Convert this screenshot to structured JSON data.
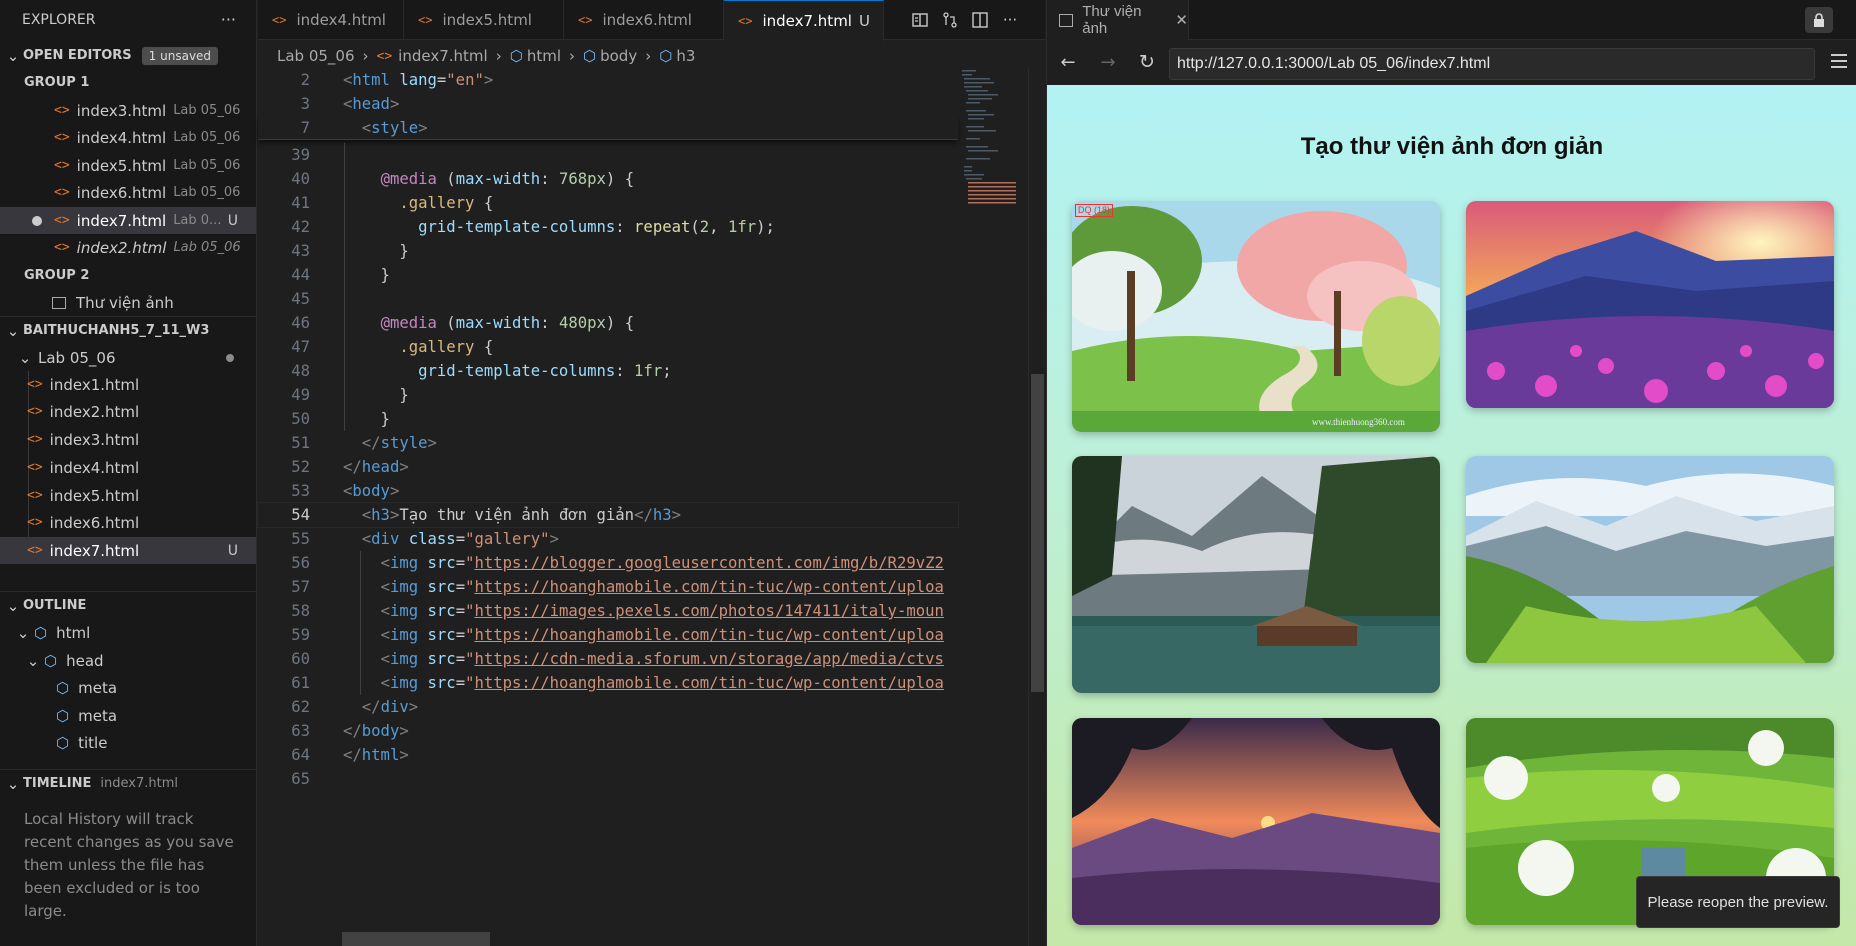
{
  "explorer": {
    "title": "EXPLORER",
    "more": "···",
    "open_editors": {
      "label": "OPEN EDITORS",
      "badge": "1 unsaved",
      "group1": "GROUP 1",
      "group1_files": [
        {
          "name": "index3.html",
          "desc": "Lab 05_06"
        },
        {
          "name": "index4.html",
          "desc": "Lab 05_06"
        },
        {
          "name": "index5.html",
          "desc": "Lab 05_06"
        },
        {
          "name": "index6.html",
          "desc": "Lab 05_06"
        },
        {
          "name": "index7.html",
          "desc": "Lab 0...",
          "status": "U"
        },
        {
          "name": "index2.html",
          "desc": "Lab 05_06"
        }
      ],
      "group2": "GROUP 2",
      "group2_files": [
        {
          "name": "Thư viện ảnh"
        }
      ]
    },
    "workspace": {
      "label": "BAITHUCHANH5_7_11_W3",
      "folder": "Lab 05_06",
      "files": [
        "index1.html",
        "index2.html",
        "index3.html",
        "index4.html",
        "index5.html",
        "index6.html",
        "index7.html"
      ],
      "index7_status": "U"
    },
    "outline": {
      "label": "OUTLINE",
      "items": [
        "html",
        "head",
        "meta",
        "meta",
        "title"
      ]
    },
    "timeline": {
      "label": "TIMELINE",
      "file": "index7.html",
      "message": "Local History will track recent changes as you save them unless the file has been excluded or is too large."
    }
  },
  "editor": {
    "tabs": [
      {
        "label": "index4.html"
      },
      {
        "label": "index5.html"
      },
      {
        "label": "index6.html"
      },
      {
        "label": "index7.html",
        "status": "U"
      }
    ],
    "breadcrumb": [
      "Lab 05_06",
      "index7.html",
      "html",
      "body",
      "h3"
    ],
    "lines": [
      "2",
      "3",
      "7",
      "39",
      "40",
      "41",
      "42",
      "43",
      "44",
      "45",
      "46",
      "47",
      "48",
      "49",
      "50",
      "51",
      "52",
      "53",
      "54",
      "55",
      "56",
      "57",
      "58",
      "59",
      "60",
      "61",
      "62",
      "63",
      "64",
      "65"
    ],
    "current_line": "54",
    "img_urls": [
      "https://blogger.googleusercontent.com/img/b/R29vZ2",
      "https://hoanghamobile.com/tin-tuc/wp-content/uploa",
      "https://images.pexels.com/photos/147411/italy-moun",
      "https://hoanghamobile.com/tin-tuc/wp-content/uploa",
      "https://cdn-media.sforum.vn/storage/app/media/ctvs",
      "https://hoanghamobile.com/tin-tuc/wp-content/uploa"
    ],
    "h3_text": "Tạo thư viện ảnh đơn giản"
  },
  "browser": {
    "tab_title": "Thư viện ảnh",
    "url": "http://127.0.0.1:3000/Lab 05_06/index7.html",
    "page_title": "Tạo thư viện ảnh đơn giản",
    "watermark": "www.thienhuong360.com",
    "stamp": "DQ (18)"
  },
  "toast": "Please reopen the preview.",
  "colors": {
    "accent": "#0078d4",
    "file_icon": "#e37933"
  }
}
